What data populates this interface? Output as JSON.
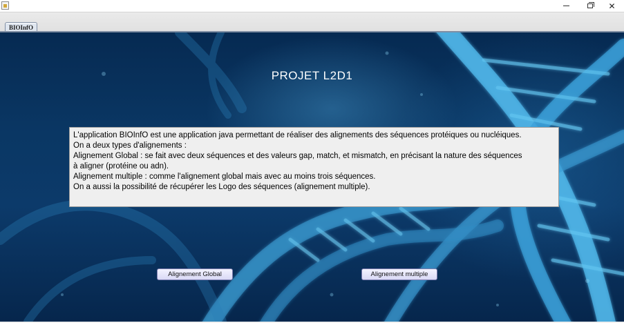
{
  "window": {
    "minimize_icon": "minimize-icon",
    "maximize_icon": "restore-icon",
    "close_glyph": "✕"
  },
  "tabs": [
    {
      "label": "BIOInfO"
    }
  ],
  "main": {
    "title": "PROJET L2D1",
    "description_lines": [
      "L'application BIOInfO est une application java permettant de réaliser des alignements des séquences protéiques ou nucléiques.",
      "On a deux types d'alignements :",
      "Alignement Global : se fait avec deux séquences et des valeurs gap, match, et mismatch, en précisant la nature des séquences",
      "à aligner (protéine ou adn).",
      "Alignement multiple : comme l'alignement global mais avec au moins trois séquences.",
      "On a aussi la possibilité de récupérer les Logo des séquences (alignement multiple)."
    ],
    "buttons": {
      "global": "Alignement Global",
      "multiple": "Alignement multiple"
    }
  },
  "colors": {
    "background_dark": "#062a52",
    "helix_glow": "#5fc3f0",
    "button_fill": "#e6e6fa"
  }
}
